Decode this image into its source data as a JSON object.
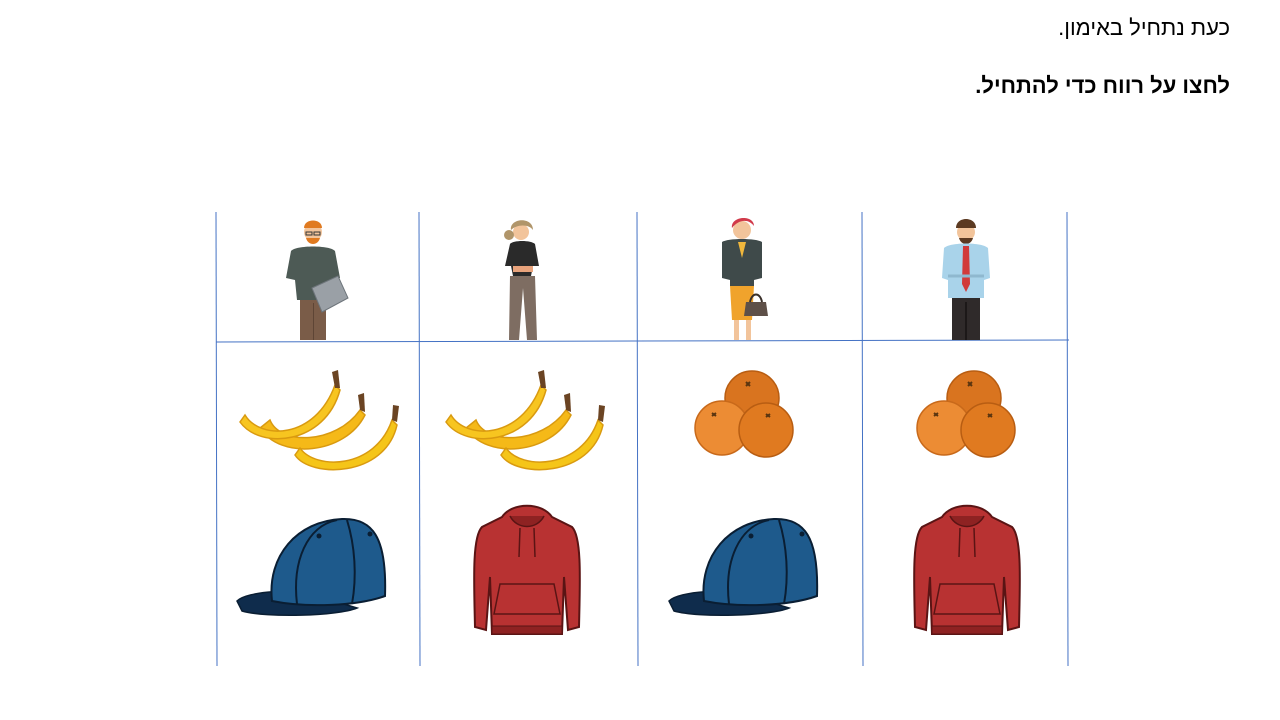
{
  "instructions": {
    "line1": "כעת נתחיל באימון.",
    "line2": "לחצו על רווח כדי להתחיל."
  },
  "columns": [
    {
      "person": "man-glasses-laptop-icon",
      "fruit": "bananas-icon",
      "clothing": "blue-cap-icon"
    },
    {
      "person": "woman-casual-icon",
      "fruit": "bananas-icon",
      "clothing": "red-hoodie-icon"
    },
    {
      "person": "woman-handbag-icon",
      "fruit": "oranges-icon",
      "clothing": "blue-cap-icon"
    },
    {
      "person": "man-tie-icon",
      "fruit": "oranges-icon",
      "clothing": "red-hoodie-icon"
    }
  ],
  "colors": {
    "grid_line": "#4472c4",
    "banana": "#f5c518",
    "orange": "#e8832a",
    "cap": "#1e5a8c",
    "hoodie": "#b83232"
  }
}
